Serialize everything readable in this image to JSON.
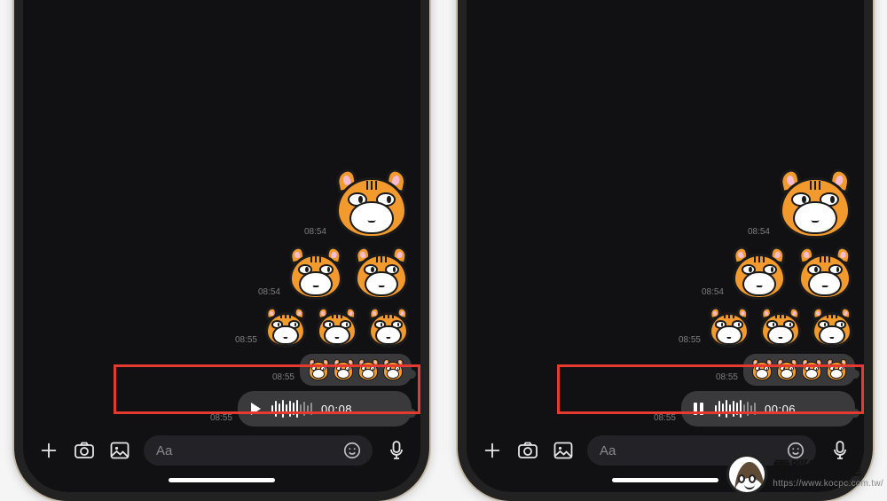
{
  "panels": [
    {
      "messages": [
        {
          "time": "08:54",
          "sticker_count": 1,
          "size": "big"
        },
        {
          "time": "08:54",
          "sticker_count": 2,
          "size": "med"
        },
        {
          "time": "08:55",
          "sticker_count": 3,
          "size": "small"
        },
        {
          "time": "08:55",
          "sticker_count": 4,
          "size": "mini"
        }
      ],
      "voice": {
        "time": "08:55",
        "state": "play",
        "duration": "00:08"
      }
    },
    {
      "messages": [
        {
          "time": "08:54",
          "sticker_count": 1,
          "size": "big"
        },
        {
          "time": "08:54",
          "sticker_count": 2,
          "size": "med"
        },
        {
          "time": "08:55",
          "sticker_count": 3,
          "size": "small"
        },
        {
          "time": "08:55",
          "sticker_count": 4,
          "size": "mini"
        }
      ],
      "voice": {
        "time": "08:55",
        "state": "pause",
        "duration": "00:06"
      }
    }
  ],
  "input": {
    "placeholder": "Aa"
  },
  "watermark": {
    "title": "電腦王阿達",
    "url": "https://www.kocpc.com.tw/"
  },
  "colors": {
    "highlight": "#e53a2f"
  }
}
